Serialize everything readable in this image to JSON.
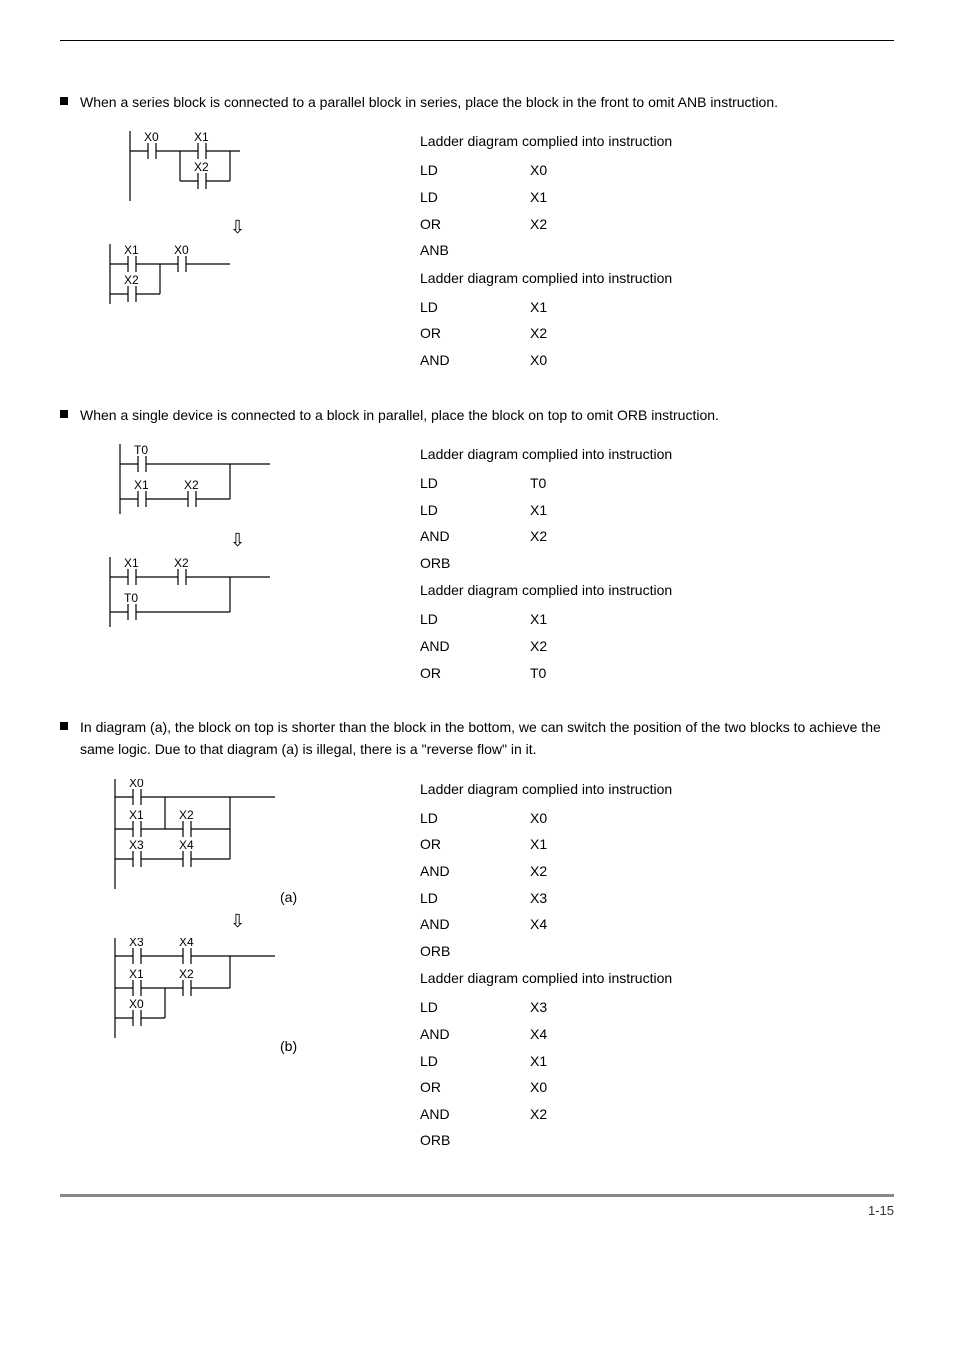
{
  "bullets": {
    "b1": "When a series block is connected to a parallel block in series, place the block in the front to omit ANB instruction.",
    "b2": "When a single device is connected to a block in parallel, place the block on top to omit ORB instruction.",
    "b3": "In diagram (a), the block on top is shorter than the block in the bottom, we can switch the position of the two blocks to achieve the same logic. Due to that diagram (a) is illegal, there is a \"reverse flow\" in it."
  },
  "heading": "Ladder diagram complied into instruction",
  "arrow": "⇩",
  "labels": {
    "a": "(a)",
    "b": "(b)"
  },
  "footer": "1-15",
  "dia1": {
    "top": {
      "c0": "X0",
      "c1": "X1",
      "c2": "X2"
    },
    "bot": {
      "c0": "X1",
      "c1": "X2",
      "c2": "X0"
    }
  },
  "dia2": {
    "top": {
      "c0": "T0",
      "c1": "X1",
      "c2": "X2"
    },
    "bot": {
      "c0": "X1",
      "c1": "X2",
      "c2": "T0"
    }
  },
  "dia3": {
    "top": {
      "c0": "X0",
      "c1": "X1",
      "c2": "X2",
      "c3": "X3",
      "c4": "X4"
    },
    "bot": {
      "c0": "X3",
      "c1": "X4",
      "c2": "X1",
      "c3": "X2",
      "c4": "X0"
    }
  },
  "inst1a": [
    {
      "op": "LD",
      "arg": "X0"
    },
    {
      "op": "LD",
      "arg": "X1"
    },
    {
      "op": "OR",
      "arg": "X2"
    },
    {
      "op": "ANB",
      "arg": ""
    }
  ],
  "inst1b": [
    {
      "op": "LD",
      "arg": "X1"
    },
    {
      "op": "OR",
      "arg": "X2"
    },
    {
      "op": "AND",
      "arg": "X0"
    }
  ],
  "inst2a": [
    {
      "op": "LD",
      "arg": "T0"
    },
    {
      "op": "LD",
      "arg": "X1"
    },
    {
      "op": "AND",
      "arg": "X2"
    },
    {
      "op": "ORB",
      "arg": ""
    }
  ],
  "inst2b": [
    {
      "op": "LD",
      "arg": "X1"
    },
    {
      "op": "AND",
      "arg": "X2"
    },
    {
      "op": "OR",
      "arg": "T0"
    }
  ],
  "inst3a": [
    {
      "op": "LD",
      "arg": "X0"
    },
    {
      "op": "OR",
      "arg": "X1"
    },
    {
      "op": "AND",
      "arg": "X2"
    },
    {
      "op": "LD",
      "arg": "X3"
    },
    {
      "op": "AND",
      "arg": "X4"
    },
    {
      "op": "ORB",
      "arg": ""
    }
  ],
  "inst3b": [
    {
      "op": "LD",
      "arg": "X3"
    },
    {
      "op": "AND",
      "arg": "X4"
    },
    {
      "op": "LD",
      "arg": "X1"
    },
    {
      "op": "OR",
      "arg": "X0"
    },
    {
      "op": "AND",
      "arg": "X2"
    },
    {
      "op": "ORB",
      "arg": ""
    }
  ]
}
